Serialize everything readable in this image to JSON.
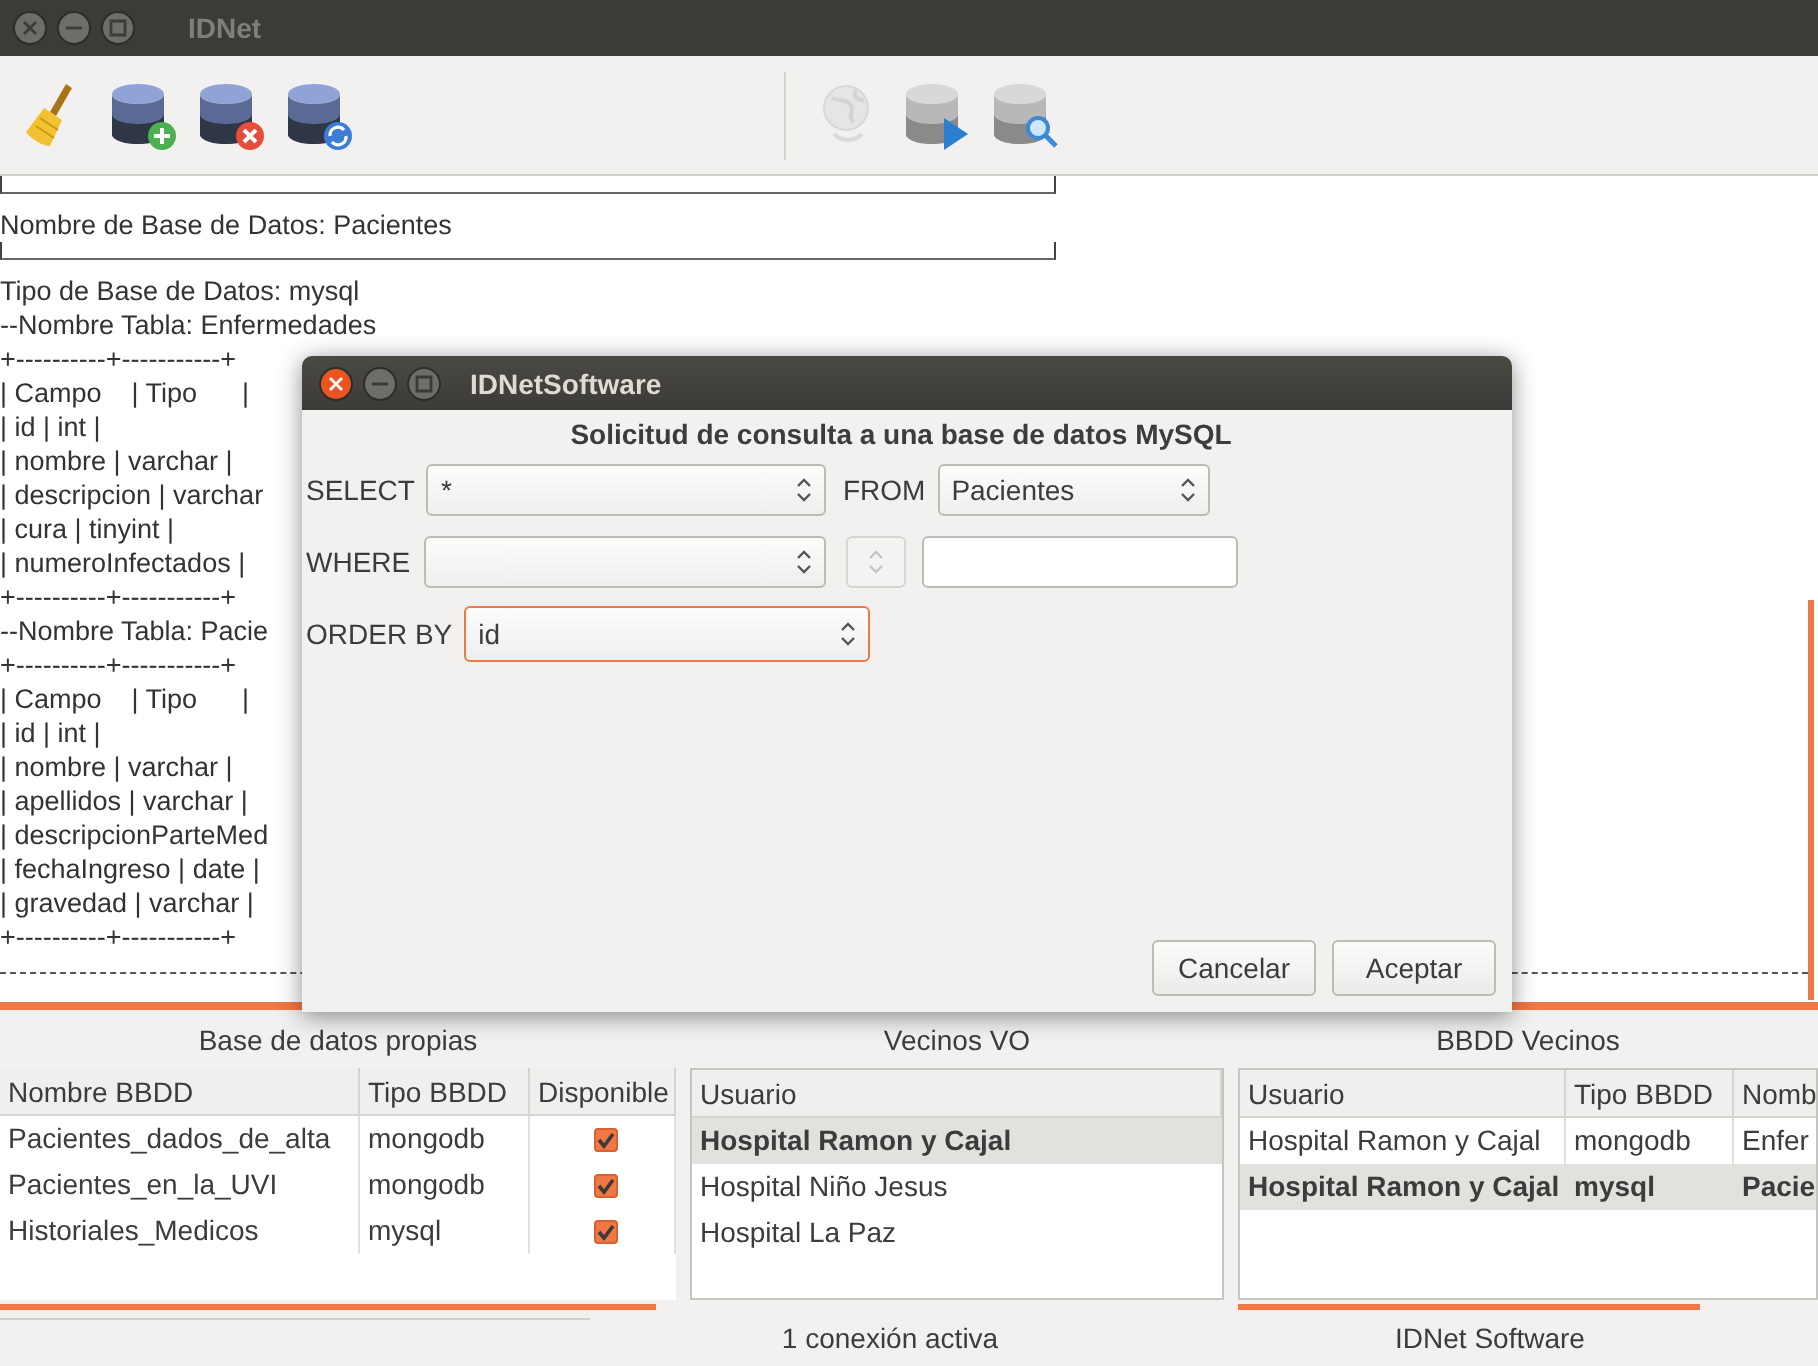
{
  "window": {
    "title": "IDNet"
  },
  "toolbar": [
    {
      "kind": "broom",
      "disabled": false
    },
    {
      "kind": "db-add",
      "disabled": false
    },
    {
      "kind": "db-remove",
      "disabled": false
    },
    {
      "kind": "db-refresh",
      "disabled": false
    },
    {
      "kind": "separator"
    },
    {
      "kind": "globe",
      "disabled": true
    },
    {
      "kind": "db-run",
      "disabled": false
    },
    {
      "kind": "db-search",
      "disabled": false
    }
  ],
  "console_lines": [
    {
      "kind": "rule"
    },
    {
      "kind": "text",
      "text": "Nombre de Base de Datos: Pacientes"
    },
    {
      "kind": "rule"
    },
    {
      "kind": "text",
      "text": "Tipo de Base de Datos: mysql"
    },
    {
      "kind": "text",
      "text": "--Nombre Tabla: Enfermedades"
    },
    {
      "kind": "text",
      "text": "+----------+-----------+"
    },
    {
      "kind": "text",
      "text": "| Campo    | Tipo      |"
    },
    {
      "kind": "text",
      "text": "| id | int |"
    },
    {
      "kind": "text",
      "text": "| nombre | varchar |"
    },
    {
      "kind": "text",
      "text": "| descripcion | varchar"
    },
    {
      "kind": "text",
      "text": "| cura | tinyint |"
    },
    {
      "kind": "text",
      "text": "| numeroInfectados | "
    },
    {
      "kind": "text",
      "text": "+----------+-----------+"
    },
    {
      "kind": "text",
      "text": "--Nombre Tabla: Pacie"
    },
    {
      "kind": "text",
      "text": "+----------+-----------+"
    },
    {
      "kind": "text",
      "text": "| Campo    | Tipo      |"
    },
    {
      "kind": "text",
      "text": "| id | int |"
    },
    {
      "kind": "text",
      "text": "| nombre | varchar |"
    },
    {
      "kind": "text",
      "text": "| apellidos | varchar |"
    },
    {
      "kind": "text",
      "text": "| descripcionParteMed"
    },
    {
      "kind": "text",
      "text": "| fechaIngreso | date |"
    },
    {
      "kind": "text",
      "text": "| gravedad | varchar |"
    },
    {
      "kind": "text",
      "text": "+----------+-----------+"
    },
    {
      "kind": "dashes"
    }
  ],
  "dialog": {
    "title": "IDNetSoftware",
    "heading": "Solicitud de consulta a una base de datos MySQL",
    "select": {
      "label": "SELECT",
      "value": "*",
      "focused": false
    },
    "from": {
      "label": "FROM",
      "value": "Pacientes",
      "focused": false
    },
    "where": {
      "label": "WHERE",
      "focused": false
    },
    "operator": {
      "disabled": true
    },
    "order_by": {
      "label": "ORDER BY",
      "value": "id",
      "focused": true
    },
    "buttons": [
      {
        "label": "Cancelar"
      },
      {
        "label": "Aceptar"
      }
    ]
  },
  "own_databases": {
    "title": "Base de datos propias",
    "columns": [
      "Nombre BBDD",
      "Tipo BBDD",
      "Disponible"
    ],
    "rows": [
      {
        "cells": [
          "Pacientes_dados_de_alta",
          "mongodb"
        ],
        "available": true
      },
      {
        "cells": [
          "Pacientes_en_la_UVI",
          "mongodb"
        ],
        "available": true
      },
      {
        "cells": [
          "Historiales_Medicos",
          "mysql"
        ],
        "available": true
      }
    ]
  },
  "neighbors_vo": {
    "title": "Vecinos VO",
    "columns": [
      "Usuario"
    ],
    "rows": [
      {
        "text": "Hospital Ramon y Cajal",
        "selected": true
      },
      {
        "text": "Hospital Niño Jesus",
        "selected": false
      },
      {
        "text": "Hospital La Paz",
        "selected": false
      }
    ]
  },
  "neighbor_databases": {
    "title": "BBDD Vecinos",
    "columns": [
      "Usuario",
      "Tipo BBDD",
      "Nomb"
    ],
    "rows": [
      {
        "cells": [
          "Hospital Ramon y Cajal",
          "mongodb",
          "Enfer"
        ],
        "selected": false
      },
      {
        "cells": [
          "Hospital Ramon y Cajal",
          "mysql",
          "Pacie"
        ],
        "selected": true
      }
    ]
  },
  "status_bar": [
    "1 conexión activa",
    "IDNet Software"
  ]
}
